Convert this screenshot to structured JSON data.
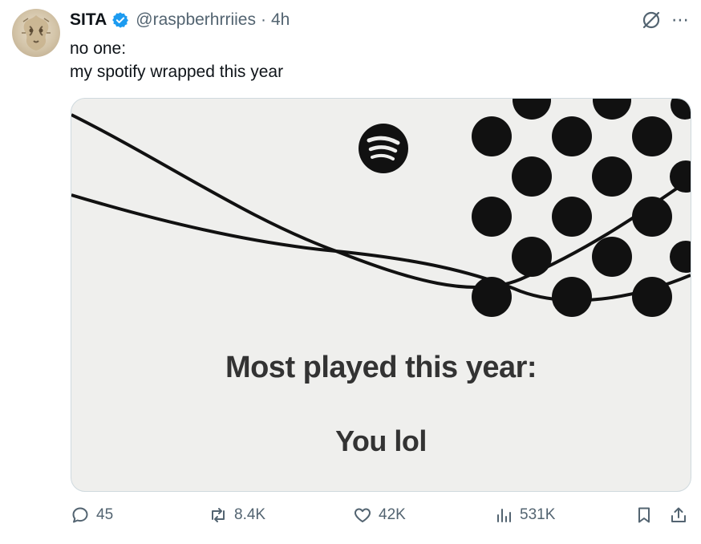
{
  "tweet": {
    "author_name": "SITA",
    "handle": "@raspberhrriies",
    "separator": "·",
    "time": "4h",
    "text_lines": [
      "no one:",
      "my spotify wrapped this year"
    ]
  },
  "media": {
    "heading": "Most played this year:",
    "subheading": "You lol",
    "icons": [
      "spotify-logo",
      "dot-pattern",
      "curved-lines"
    ]
  },
  "actions": {
    "replies": "45",
    "reposts": "8.4K",
    "likes": "42K",
    "views": "531K"
  },
  "colors": {
    "accent": "#1d9bf0",
    "muted": "#536471",
    "media_bg": "#efefed",
    "media_text": "#333333"
  }
}
